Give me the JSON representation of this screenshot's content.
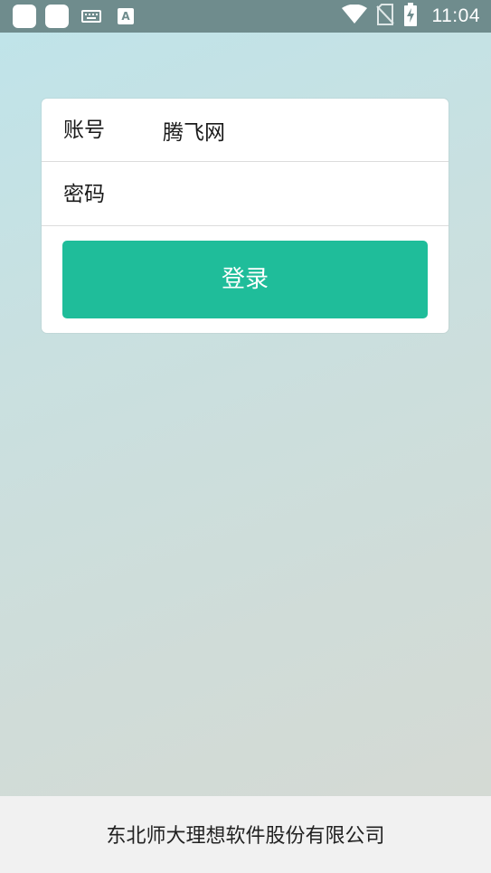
{
  "status_bar": {
    "left_icons": [
      "app-notification-icon",
      "app-notification-icon",
      "keyboard-icon",
      "text-a-icon"
    ],
    "text_icon_letter": "A",
    "right_icons": [
      "wifi-icon",
      "no-sim-icon",
      "battery-charging-icon"
    ],
    "time": "11:04"
  },
  "login_form": {
    "account_label": "账号",
    "account_value": "腾飞网",
    "password_label": "密码",
    "password_value": "",
    "login_button_label": "登录"
  },
  "footer": {
    "company": "东北师大理想软件股份有限公司"
  },
  "colors": {
    "status_bar": "#6f8c8d",
    "primary_button": "#1fbd9a",
    "card_background": "#ffffff",
    "footer_background": "#f1f1f1"
  }
}
